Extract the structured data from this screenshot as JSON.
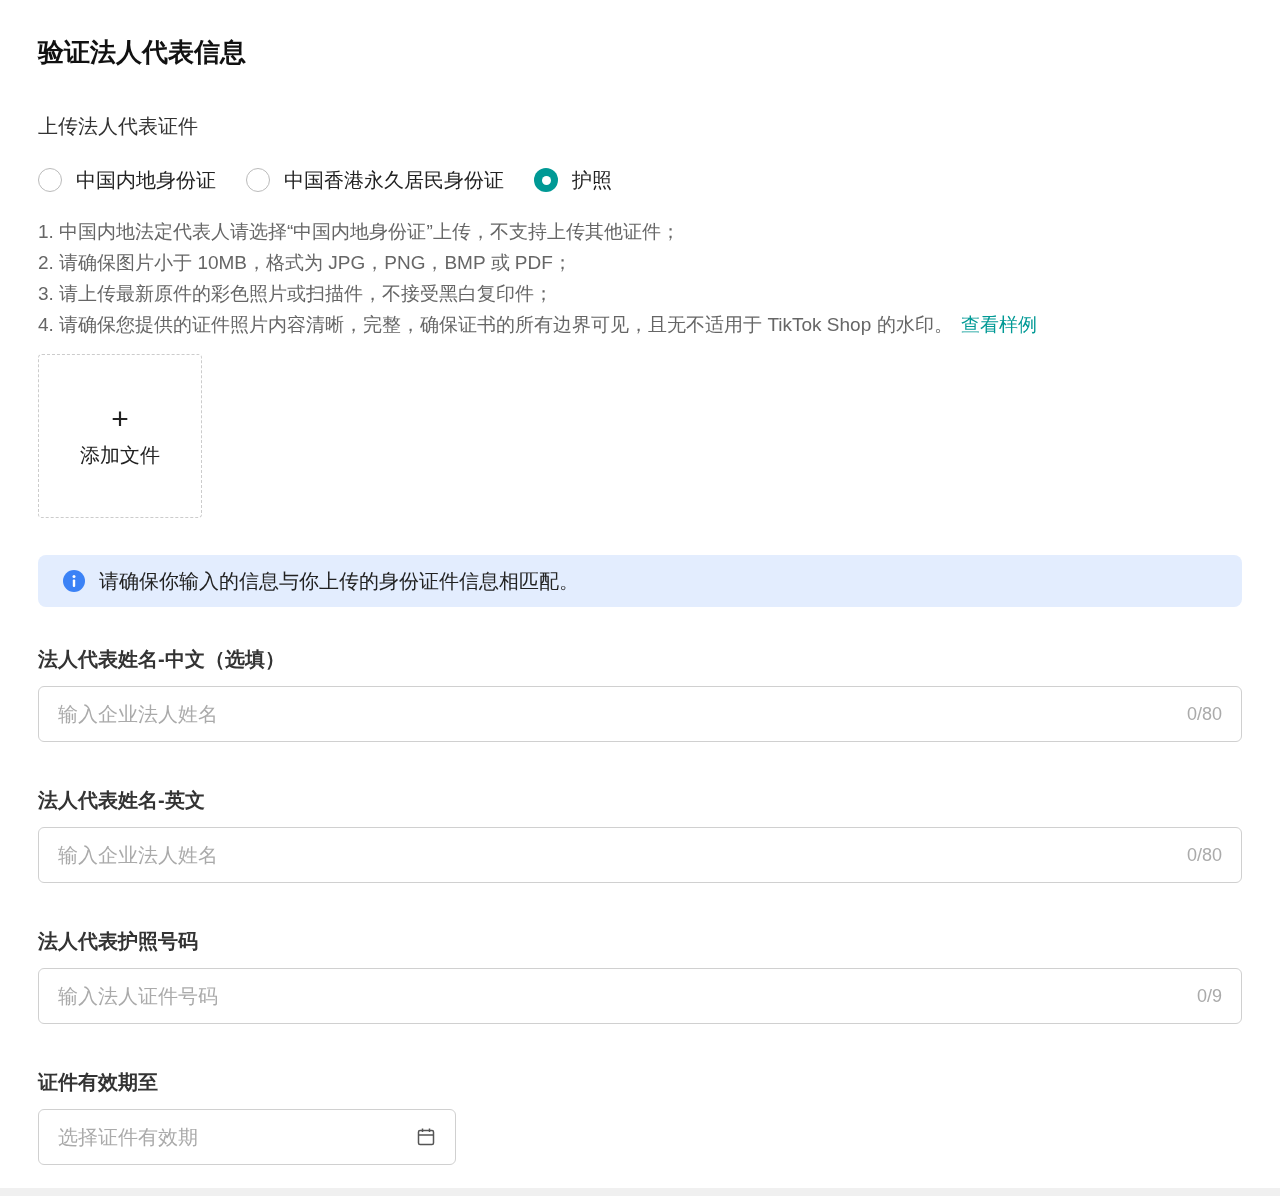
{
  "title": "验证法人代表信息",
  "upload_section": {
    "label": "上传法人代表证件",
    "id_types": [
      {
        "label": "中国内地身份证",
        "selected": false
      },
      {
        "label": "中国香港永久居民身份证",
        "selected": false
      },
      {
        "label": "护照",
        "selected": true
      }
    ],
    "notes": [
      "1. 中国内地法定代表人请选择“中国内地身份证”上传，不支持上传其他证件；",
      "2. 请确保图片小于 10MB，格式为 JPG，PNG，BMP 或 PDF；",
      "3. 请上传最新原件的彩色照片或扫描件，不接受黑白复印件；",
      "4. 请确保您提供的证件照片内容清晰，完整，确保证书的所有边界可见，且无不适用于 TikTok Shop 的水印。"
    ],
    "sample_link": "查看样例",
    "upload_button": {
      "icon": "+",
      "label": "添加文件"
    }
  },
  "info_banner": "请确保你输入的信息与你上传的身份证件信息相匹配。",
  "fields": [
    {
      "kind": "text",
      "label": "法人代表姓名-中文（选填）",
      "placeholder": "输入企业法人姓名",
      "counter": "0/80"
    },
    {
      "kind": "text",
      "label": "法人代表姓名-英文",
      "placeholder": "输入企业法人姓名",
      "counter": "0/80"
    },
    {
      "kind": "text",
      "label": "法人代表护照号码",
      "placeholder": "输入法人证件号码",
      "counter": "0/9"
    },
    {
      "kind": "date",
      "label": "证件有效期至",
      "placeholder": "选择证件有效期"
    }
  ]
}
